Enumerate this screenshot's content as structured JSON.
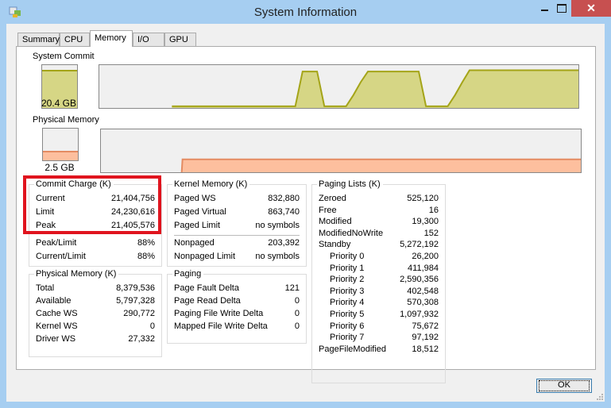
{
  "window": {
    "title": "System Information",
    "close_glyph": "✕",
    "minimize_glyph": "—",
    "maximize_glyph": "☐"
  },
  "tabs": [
    {
      "label": "Summary",
      "active": false
    },
    {
      "label": "CPU",
      "active": false
    },
    {
      "label": "Memory",
      "active": true
    },
    {
      "label": "I/O",
      "active": false
    },
    {
      "label": "GPU",
      "active": false
    }
  ],
  "system_commit": {
    "label": "System Commit",
    "value": "20.4 GB",
    "gauge_fraction": 0.88,
    "history": [
      0,
      0,
      0,
      0,
      0,
      0,
      0,
      0,
      0,
      0,
      0.04,
      0.04,
      0.04,
      0.04,
      0.04,
      0.04,
      0.04,
      0.04,
      0.04,
      0.04,
      0.04,
      0.04,
      0.04,
      0.04,
      0.04,
      0.04,
      0.04,
      0.04,
      0.85,
      0.85,
      0.85,
      0.04,
      0.04,
      0.04,
      0.04,
      0.3,
      0.6,
      0.85,
      0.85,
      0.85,
      0.85,
      0.85,
      0.85,
      0.85,
      0.85,
      0.04,
      0.04,
      0.04,
      0.04,
      0.3,
      0.6,
      0.88,
      0.88,
      0.88,
      0.88,
      0.88,
      0.88,
      0.88,
      0.88,
      0.88,
      0.88,
      0.88,
      0.88,
      0.88,
      0.88,
      0.88,
      0.88
    ],
    "color_fill": "#d6d685",
    "color_line": "#a4a418"
  },
  "physical_memory_graph": {
    "label": "Physical Memory",
    "value": "2.5 GB",
    "gauge_fraction": 0.3,
    "history_fraction": 0.3,
    "history_start_fraction": 0.17,
    "color_fill": "#fdbf9e",
    "color_line": "#e48b62"
  },
  "commit_charge": {
    "title": "Commit Charge (K)",
    "rows": [
      {
        "label": "Current",
        "value": "21,404,756"
      },
      {
        "label": "Limit",
        "value": "24,230,616"
      },
      {
        "label": "Peak",
        "value": "21,405,576"
      },
      {
        "label": "Peak/Limit",
        "value": "88%"
      },
      {
        "label": "Current/Limit",
        "value": "88%"
      }
    ]
  },
  "physical_memory": {
    "title": "Physical Memory (K)",
    "rows": [
      {
        "label": "Total",
        "value": "8,379,536"
      },
      {
        "label": "Available",
        "value": "5,797,328"
      },
      {
        "label": "Cache WS",
        "value": "290,772"
      },
      {
        "label": "Kernel WS",
        "value": "0"
      },
      {
        "label": "Driver WS",
        "value": "27,332"
      }
    ]
  },
  "kernel_memory": {
    "title": "Kernel Memory (K)",
    "rows": [
      {
        "label": "Paged WS",
        "value": "832,880"
      },
      {
        "label": "Paged Virtual",
        "value": "863,740"
      },
      {
        "label": "Paged Limit",
        "value": "no symbols"
      },
      {
        "label": "Nonpaged",
        "value": "203,392"
      },
      {
        "label": "Nonpaged Limit",
        "value": "no symbols"
      }
    ]
  },
  "paging": {
    "title": "Paging",
    "rows": [
      {
        "label": "Page Fault Delta",
        "value": "121"
      },
      {
        "label": "Page Read Delta",
        "value": "0"
      },
      {
        "label": "Paging File Write Delta",
        "value": "0"
      },
      {
        "label": "Mapped File Write Delta",
        "value": "0"
      }
    ]
  },
  "paging_lists": {
    "title": "Paging Lists (K)",
    "rows": [
      {
        "label": "Zeroed",
        "value": "525,120"
      },
      {
        "label": "Free",
        "value": "16"
      },
      {
        "label": "Modified",
        "value": "19,300"
      },
      {
        "label": "ModifiedNoWrite",
        "value": "152"
      },
      {
        "label": "Standby",
        "value": "5,272,192"
      },
      {
        "label": "Priority 0",
        "value": "26,200"
      },
      {
        "label": "Priority 1",
        "value": "411,984"
      },
      {
        "label": "Priority 2",
        "value": "2,590,356"
      },
      {
        "label": "Priority 3",
        "value": "402,548"
      },
      {
        "label": "Priority 4",
        "value": "570,308"
      },
      {
        "label": "Priority 5",
        "value": "1,097,932"
      },
      {
        "label": "Priority 6",
        "value": "75,672"
      },
      {
        "label": "Priority 7",
        "value": "97,192"
      },
      {
        "label": "PageFileModified",
        "value": "18,512"
      }
    ]
  },
  "buttons": {
    "ok_label": "OK"
  }
}
